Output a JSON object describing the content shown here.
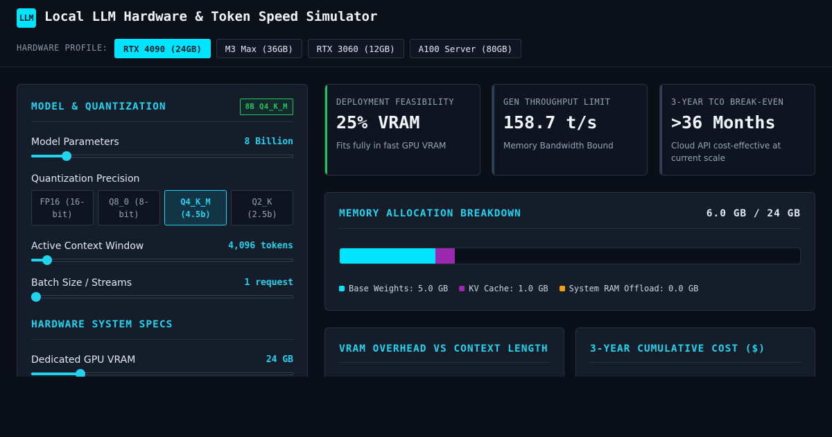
{
  "app": {
    "logo_text": "LLM",
    "title": "Local LLM Hardware & Token Speed Simulator"
  },
  "hardware": {
    "label": "HARDWARE PROFILE:",
    "profiles": [
      "RTX 4090 (24GB)",
      "M3 Max (36GB)",
      "RTX 3060 (12GB)",
      "A100 Server (80GB)"
    ],
    "selected": "RTX 4090 (24GB)"
  },
  "model_panel": {
    "title": "MODEL & QUANTIZATION",
    "badge": "8B Q4_K_M",
    "params_label": "Model Parameters",
    "params_value": "8 Billion",
    "params_fraction": 0.12,
    "quant_label": "Quantization Precision",
    "quant_options": [
      "FP16 (16-bit)",
      "Q8_0 (8-bit)",
      "Q4_K_M (4.5b)",
      "Q2_K (2.5b)"
    ],
    "quant_selected": "Q4_K_M (4.5b)",
    "context_label": "Active Context Window",
    "context_value": "4,096 tokens",
    "context_fraction": 0.045,
    "batch_label": "Batch Size / Streams",
    "batch_value": "1 request",
    "batch_fraction": 0.0,
    "hw_specs_title": "HARDWARE SYSTEM SPECS",
    "vram_label": "Dedicated GPU VRAM",
    "vram_value": "24 GB",
    "vram_fraction": 0.175
  },
  "kpis": [
    {
      "title": "DEPLOYMENT FEASIBILITY",
      "value": "25% VRAM",
      "sub": "Fits fully in fast GPU VRAM",
      "accent": "#22c55e"
    },
    {
      "title": "GEN THROUGHPUT LIMIT",
      "value": "158.7 t/s",
      "sub": "Memory Bandwidth Bound",
      "accent": "#334155"
    },
    {
      "title": "3-YEAR TCO BREAK-EVEN",
      "value": ">36 Months",
      "sub": "Cloud API cost-effective at current scale",
      "accent": "#334155"
    }
  ],
  "memory": {
    "title": "MEMORY ALLOCATION BREAKDOWN",
    "total": "6.0 GB / 24 GB",
    "capacity_gb": 24,
    "segments": [
      {
        "name": "Base Weights:",
        "value_text": "5.0 GB",
        "gb": 5.0,
        "color": "#00e5ff"
      },
      {
        "name": "KV Cache:",
        "value_text": "1.0 GB",
        "gb": 1.0,
        "color": "#9c27b0"
      },
      {
        "name": "System RAM Offload:",
        "value_text": "0.0 GB",
        "gb": 0.0,
        "color": "#f59e0b"
      }
    ]
  },
  "bottom": {
    "vram_chart_title": "VRAM OVERHEAD VS CONTEXT LENGTH",
    "cost_chart_title": "3-YEAR CUMULATIVE COST ($)"
  }
}
